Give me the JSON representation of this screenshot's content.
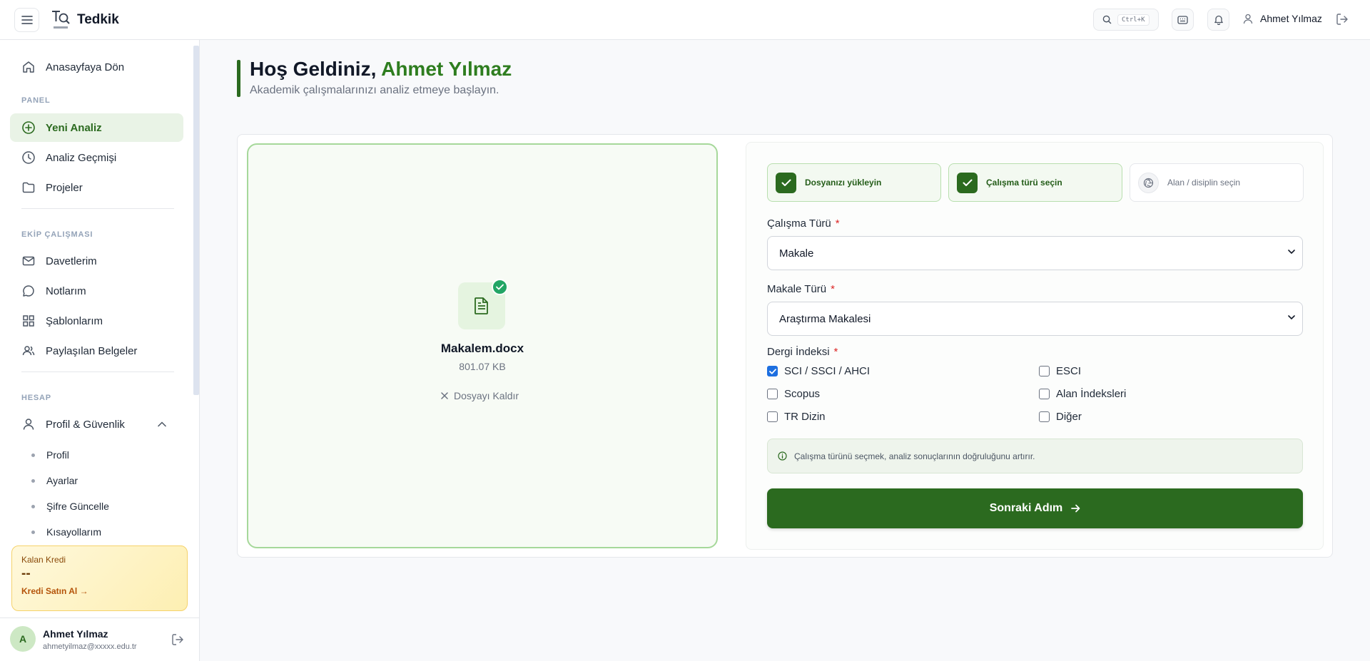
{
  "header": {
    "brand": "Tedkik",
    "search_shortcut": "Ctrl+K",
    "user_name": "Ahmet Yılmaz"
  },
  "sidebar": {
    "home": "Anasayfaya Dön",
    "panel_label": "PANEL",
    "panel_items": [
      {
        "label": "Yeni Analiz",
        "icon": "plus-circle-icon",
        "active": true
      },
      {
        "label": "Analiz Geçmişi",
        "icon": "clock-icon"
      },
      {
        "label": "Projeler",
        "icon": "folder-icon"
      }
    ],
    "team_label": "EKİP ÇALIŞMASI",
    "team_items": [
      {
        "label": "Davetlerim",
        "icon": "mail-icon"
      },
      {
        "label": "Notlarım",
        "icon": "message-icon"
      },
      {
        "label": "Şablonlarım",
        "icon": "grid-icon"
      },
      {
        "label": "Paylaşılan Belgeler",
        "icon": "users-icon"
      }
    ],
    "account_label": "HESAP",
    "profile_group": "Profil & Güvenlik",
    "profile_items": [
      "Profil",
      "Ayarlar",
      "Şifre Güncelle",
      "Kısayollarım"
    ],
    "credit": {
      "title": "Kalan Kredi",
      "value": "--",
      "link": "Kredi Satın Al →"
    },
    "user": {
      "initial": "A",
      "name": "Ahmet Yılmaz",
      "email": "ahmetyilmaz@xxxxx.edu.tr"
    }
  },
  "main": {
    "greeting": "Hoş Geldiniz, ",
    "greeting_name": "Ahmet Yılmaz",
    "subtitle": "Akademik çalışmalarınızı analiz etmeye başlayın.",
    "file": {
      "name": "Makalem.docx",
      "size": "801.07 KB",
      "remove_label": "Dosyayı Kaldır"
    },
    "steps": [
      {
        "label": "Dosyanızı yükleyin",
        "status": "done"
      },
      {
        "label": "Çalışma türü seçin",
        "status": "done"
      },
      {
        "label": "Alan / disiplin seçin",
        "status": "todo"
      }
    ],
    "work_type": {
      "label": "Çalışma Türü",
      "required": "*",
      "value": "Makale"
    },
    "article_type": {
      "label": "Makale Türü",
      "required": "*",
      "value": "Araştırma Makalesi"
    },
    "index": {
      "label": "Dergi İndeksi",
      "required": "*",
      "options": [
        {
          "label": "SCI / SSCI / AHCI",
          "checked": true
        },
        {
          "label": "ESCI",
          "checked": false
        },
        {
          "label": "Scopus",
          "checked": false
        },
        {
          "label": "Alan İndeksleri",
          "checked": false
        },
        {
          "label": "TR Dizin",
          "checked": false
        },
        {
          "label": "Diğer",
          "checked": false
        }
      ]
    },
    "info_text": "Çalışma türünü seçmek, analiz sonuçlarının doğruluğunu artırır.",
    "next_label": "Sonraki Adım"
  },
  "colors": {
    "primary": "#2b6a1f",
    "accent_green": "#2e7d1f",
    "checkbox_blue": "#1d6fe0"
  }
}
